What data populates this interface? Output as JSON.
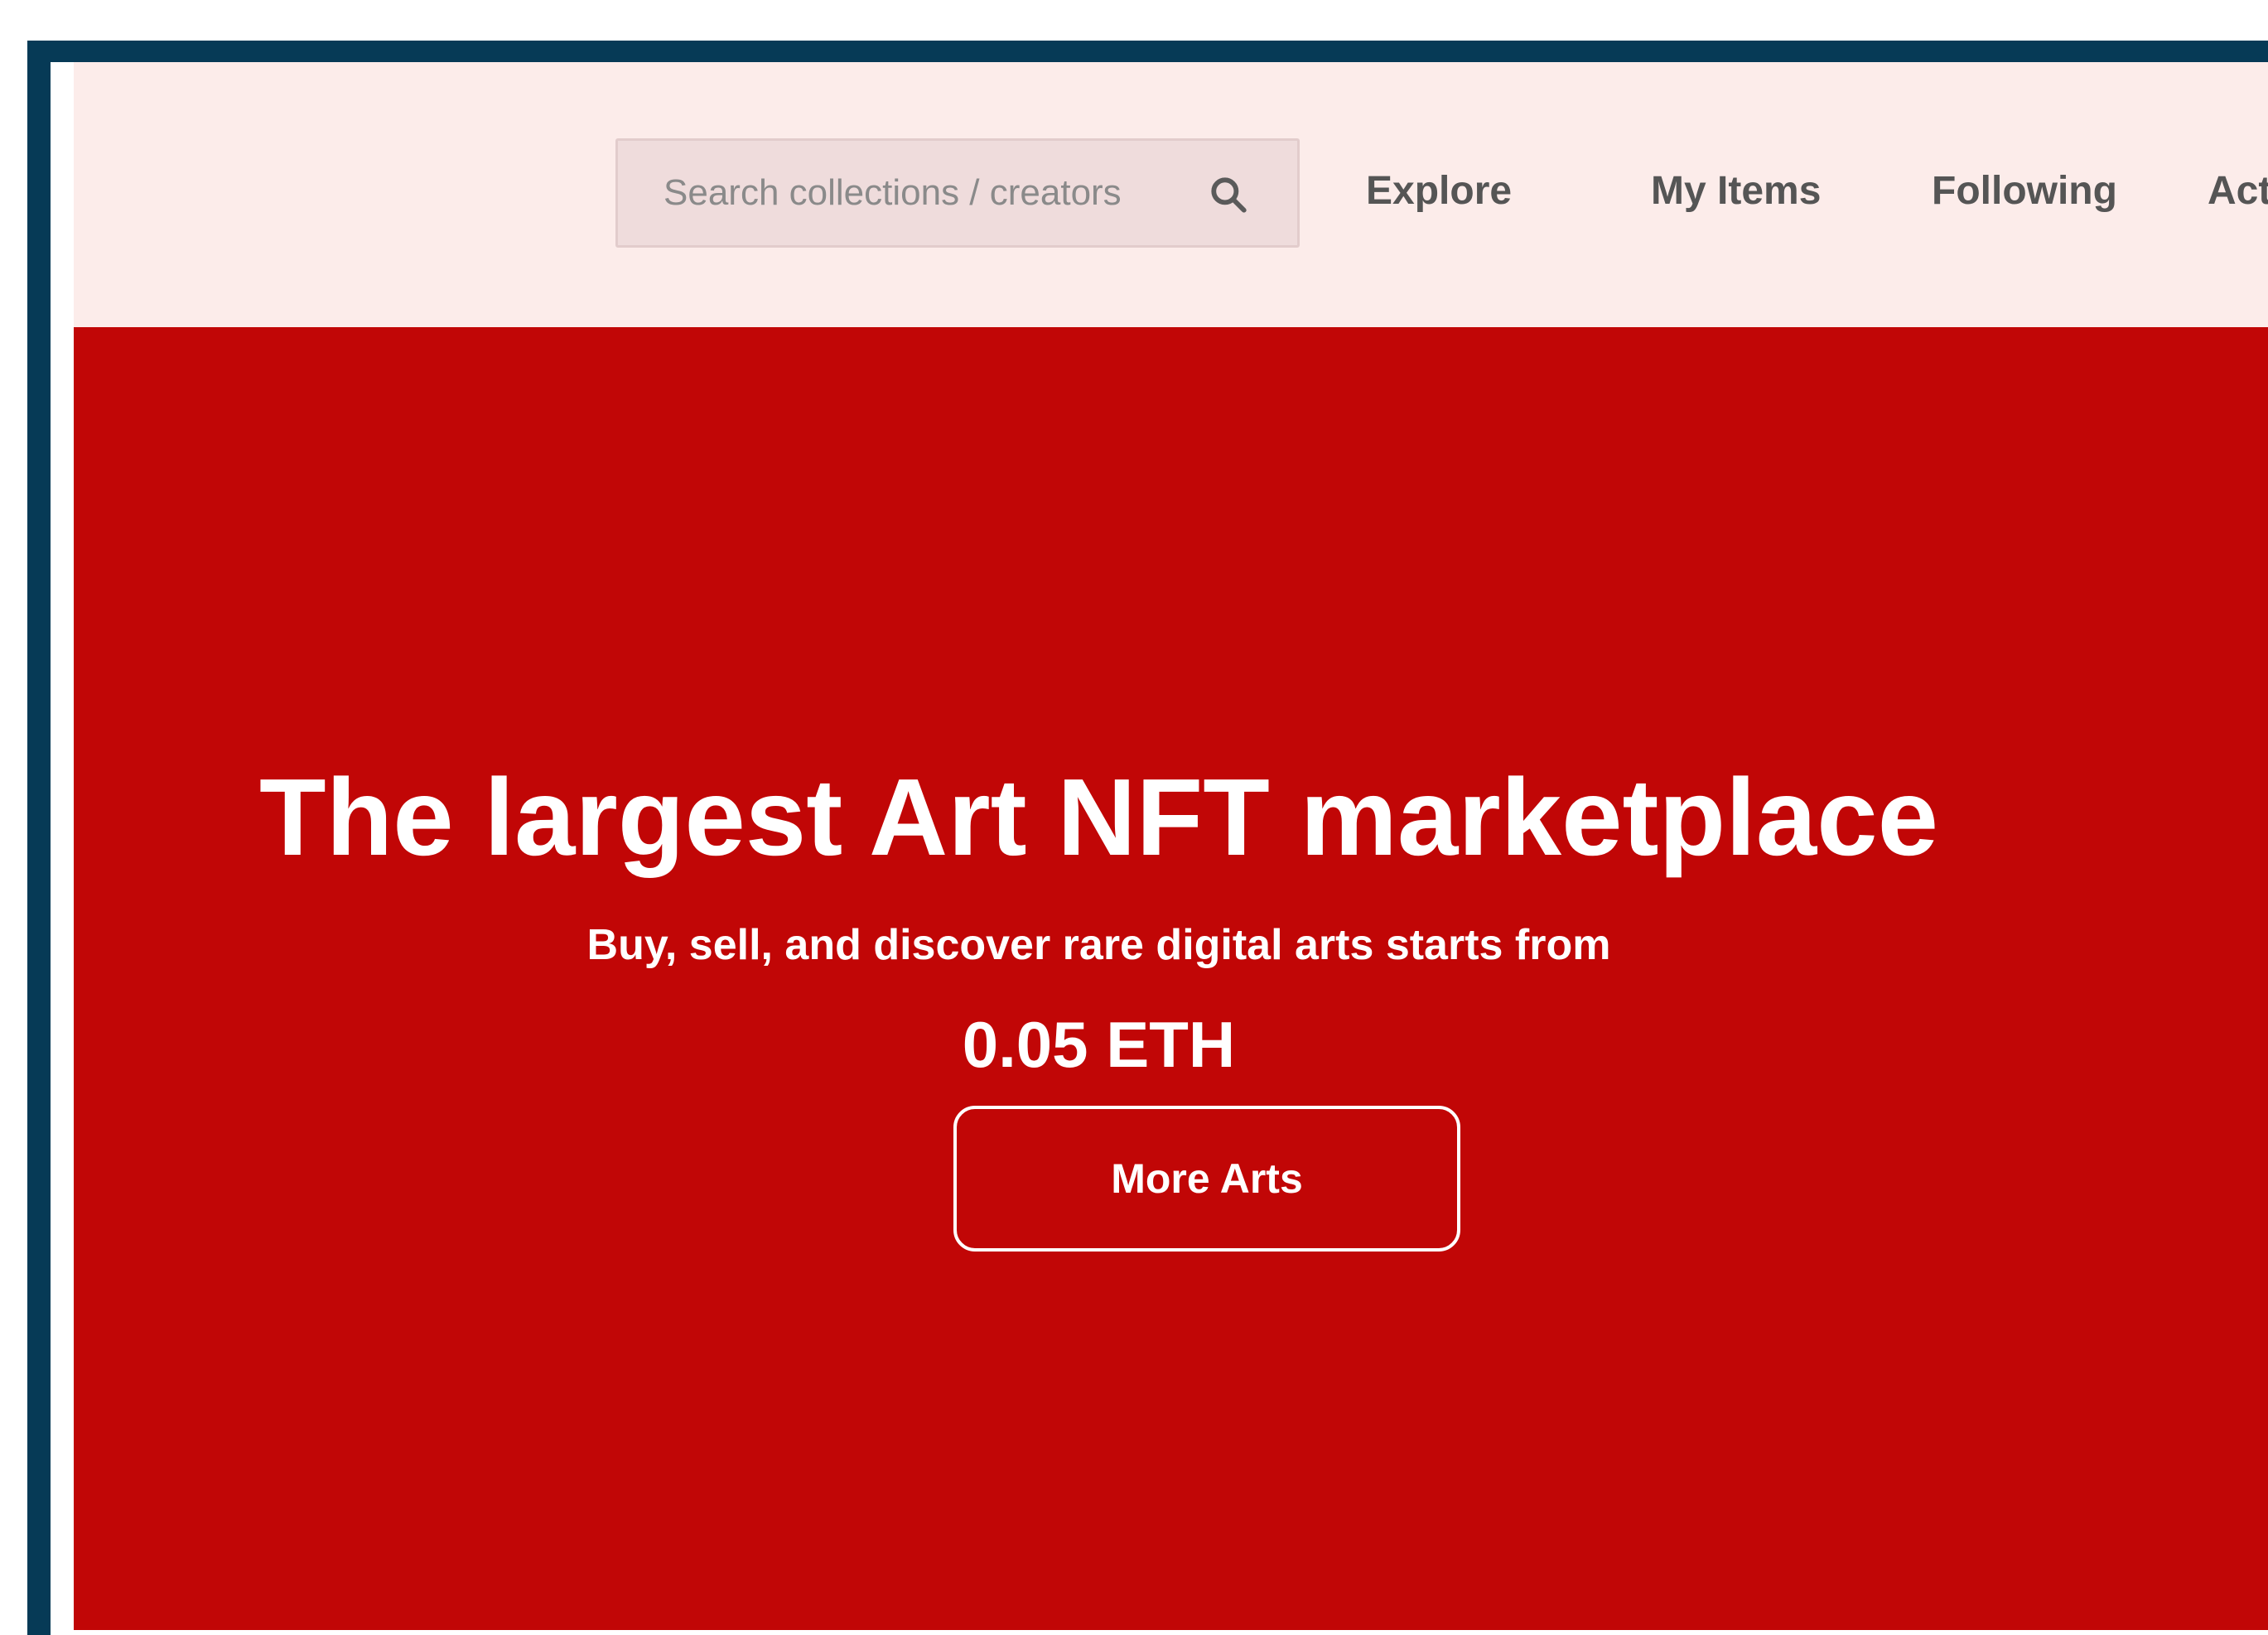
{
  "search": {
    "placeholder": "Search collections / creators",
    "icon": "search-icon"
  },
  "nav": {
    "items": [
      {
        "label": "Explore"
      },
      {
        "label": "My Items"
      },
      {
        "label": "Following"
      },
      {
        "label": "Activity"
      }
    ]
  },
  "hero": {
    "title": "The largest Art NFT marketplace",
    "subtitle": "Buy, sell, and discover rare digital arts starts from",
    "price": "0.05 ETH",
    "cta_label": "More Arts"
  },
  "colors": {
    "frame": "#063a56",
    "navbar_bg": "#fcecea",
    "hero_bg": "#c10606",
    "nav_text": "#555555",
    "hero_text": "#ffffff"
  }
}
